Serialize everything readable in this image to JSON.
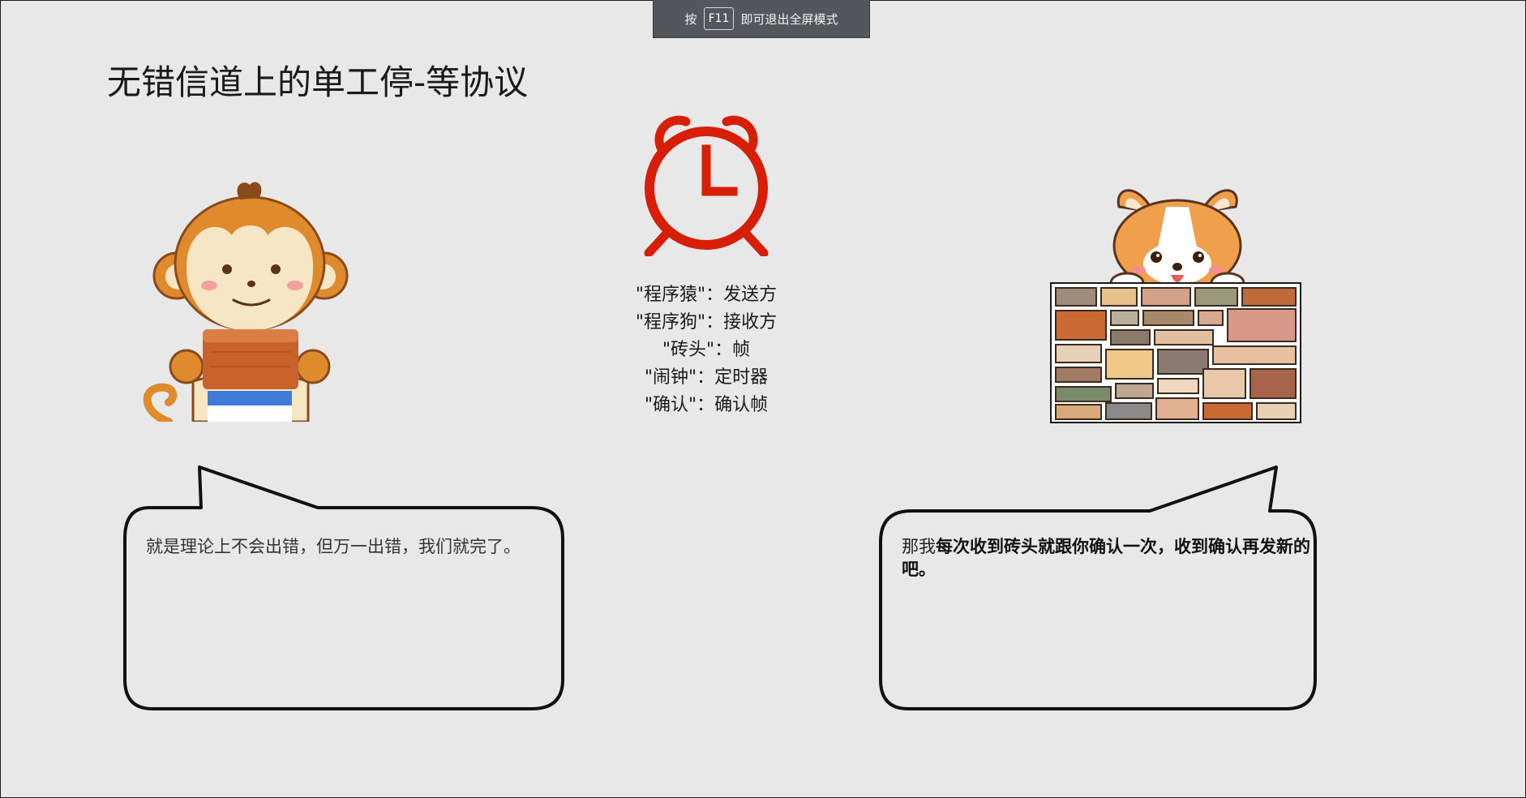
{
  "fullscreen_hint": {
    "prefix": "按",
    "key": "F11",
    "suffix": "即可退出全屏模式"
  },
  "slide": {
    "title": "无错信道上的单工停-等协议",
    "legend": [
      "\"程序猿\"：发送方",
      "\"程序狗\"：接收方",
      "\"砖头\"：帧",
      "\"闹钟\"：定时器",
      "\"确认\"：确认帧"
    ],
    "bubble_left": {
      "text": "就是理论上不会出错，但万一出错，我们就完了。"
    },
    "bubble_right": {
      "prefix": "那我",
      "bold": "每次收到砖头就跟你确认一次，收到确认再发新的吧。"
    }
  },
  "illustrations": {
    "monkey": "monkey-holding-brick-illustration",
    "clock": "alarm-clock-icon",
    "corgi": "corgi-behind-brick-wall-illustration"
  },
  "colors": {
    "background": "#e8e8e8",
    "clock_red": "#d81e06",
    "bubble_border": "#111111",
    "hint_bar": "#53565a"
  }
}
